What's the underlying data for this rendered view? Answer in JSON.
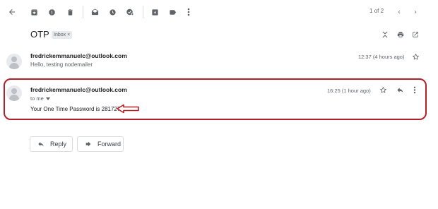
{
  "toolbar": {
    "pagination": "1 of 2"
  },
  "thread": {
    "subject": "OTP",
    "label": "Inbox",
    "label_close": "×"
  },
  "messages": [
    {
      "sender": "fredrickemmanuelc@outlook.com",
      "snippet": "Hello, testing nodemailer",
      "time": "12:37 (4 hours ago)"
    },
    {
      "sender": "fredrickemmanuelc@outlook.com",
      "recipient": "to me",
      "time": "16:25 (1 hour ago)",
      "body": "Your One Time Password is 281727"
    }
  ],
  "actions": {
    "reply": "Reply",
    "forward": "Forward"
  },
  "colors": {
    "highlight": "#b3202a",
    "icon": "#5f6368",
    "chip_bg": "#e8eaed"
  },
  "icons": [
    "back-icon",
    "archive-icon",
    "spam-icon",
    "delete-icon",
    "mark-unread-icon",
    "snooze-icon",
    "add-task-icon",
    "move-to-icon",
    "label-icon",
    "more-icon",
    "prev-icon",
    "next-icon",
    "collapse-icon",
    "print-icon",
    "new-window-icon",
    "star-icon",
    "reply-icon",
    "more-vert-icon",
    "red-arrow-icon",
    "forward-icon"
  ]
}
